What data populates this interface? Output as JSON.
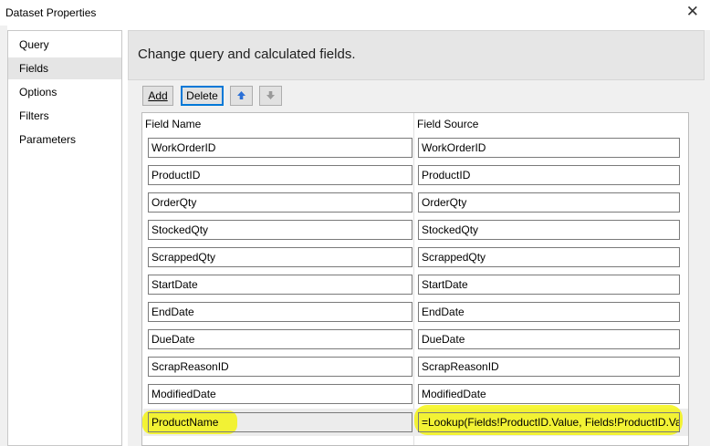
{
  "window": {
    "title": "Dataset Properties",
    "close_glyph": "✕"
  },
  "nav": {
    "items": [
      {
        "label": "Query",
        "selected": false
      },
      {
        "label": "Fields",
        "selected": true
      },
      {
        "label": "Options",
        "selected": false
      },
      {
        "label": "Filters",
        "selected": false
      },
      {
        "label": "Parameters",
        "selected": false
      }
    ]
  },
  "header": {
    "text": "Change query and calculated fields."
  },
  "toolbar": {
    "add_label": "Add",
    "delete_label": "Delete",
    "move_up_icon": "arrow-up-icon",
    "move_down_icon": "arrow-down-icon"
  },
  "grid": {
    "col_name": "Field Name",
    "col_source": "Field Source",
    "rows": [
      {
        "name": "WorkOrderID",
        "source": "WorkOrderID"
      },
      {
        "name": "ProductID",
        "source": "ProductID"
      },
      {
        "name": "OrderQty",
        "source": "OrderQty"
      },
      {
        "name": "StockedQty",
        "source": "StockedQty"
      },
      {
        "name": "ScrappedQty",
        "source": "ScrappedQty"
      },
      {
        "name": "StartDate",
        "source": "StartDate"
      },
      {
        "name": "EndDate",
        "source": "EndDate"
      },
      {
        "name": "DueDate",
        "source": "DueDate"
      },
      {
        "name": "ScrapReasonID",
        "source": "ScrapReasonID"
      },
      {
        "name": "ModifiedDate",
        "source": "ModifiedDate"
      },
      {
        "name": "ProductName",
        "source": "=Lookup(Fields!ProductID.Value, Fields!ProductID.Valu"
      }
    ]
  },
  "colors": {
    "highlight": "#f3f300",
    "focus": "#0078d7",
    "arrow_up": "#2a6fd6",
    "arrow_disabled": "#9a9a9a"
  }
}
